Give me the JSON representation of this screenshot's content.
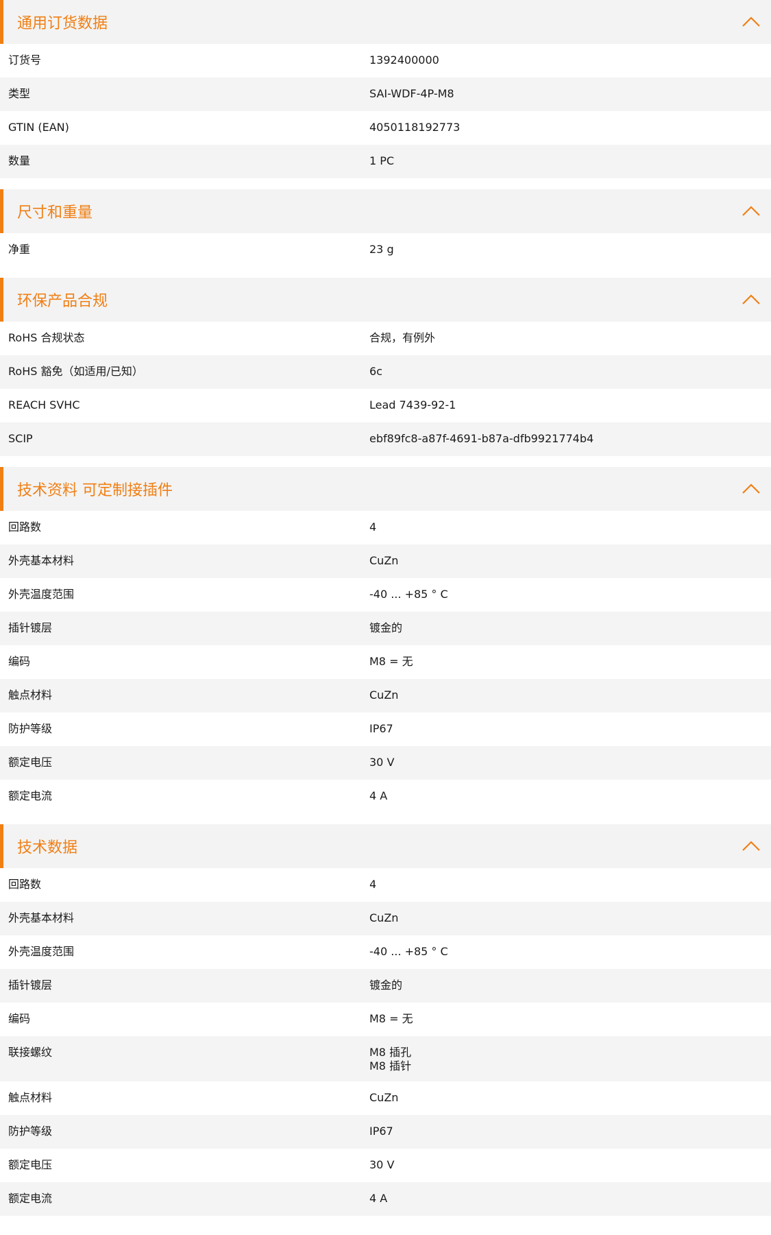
{
  "icons": {
    "collapse": "chevron-up-icon"
  },
  "colors": {
    "accent": "#f07f14",
    "header_bg": "#f3f3f3",
    "row_alt_bg": "#f4f4f4"
  },
  "sections": [
    {
      "key": "ordering",
      "title": "通用订货数据",
      "rows": [
        {
          "label": "订货号",
          "value": "1392400000"
        },
        {
          "label": "类型",
          "value": "SAI-WDF-4P-M8"
        },
        {
          "label": "GTIN (EAN)",
          "value": "4050118192773"
        },
        {
          "label": "数量",
          "value": "1  PC"
        }
      ]
    },
    {
      "key": "dimensions",
      "title": "尺寸和重量",
      "rows": [
        {
          "label": "净重",
          "value": "23  g"
        }
      ]
    },
    {
      "key": "environmental",
      "title": "环保产品合规",
      "rows": [
        {
          "label": "RoHS 合规状态",
          "value": "合规，有例外"
        },
        {
          "label": "RoHS 豁免（如适用/已知）",
          "value": "6c"
        },
        {
          "label": "REACH SVHC",
          "value": "Lead 7439-92-1"
        },
        {
          "label": "SCIP",
          "value": "ebf89fc8-a87f-4691-b87a-dfb9921774b4"
        }
      ]
    },
    {
      "key": "tech-custom",
      "title": "技术资料 可定制接插件",
      "rows": [
        {
          "label": "回路数",
          "value": "4"
        },
        {
          "label": "外壳基本材料",
          "value": "CuZn"
        },
        {
          "label": "外壳温度范围",
          "value": "-40 ... +85 ° C"
        },
        {
          "label": "插针镀层",
          "value": "镀金的"
        },
        {
          "label": "编码",
          "value": "M8 = 无"
        },
        {
          "label": "触点材料",
          "value": "CuZn"
        },
        {
          "label": "防护等级",
          "value": "IP67"
        },
        {
          "label": "额定电压",
          "value": "30  V"
        },
        {
          "label": "额定电流",
          "value": "4  A"
        }
      ]
    },
    {
      "key": "tech",
      "title": "技术数据",
      "rows": [
        {
          "label": "回路数",
          "value": "4"
        },
        {
          "label": "外壳基本材料",
          "value": "CuZn"
        },
        {
          "label": "外壳温度范围",
          "value": "-40 ... +85 ° C"
        },
        {
          "label": "插针镀层",
          "value": "镀金的"
        },
        {
          "label": "编码",
          "value": "M8 = 无"
        },
        {
          "label": "联接螺纹",
          "value": "M8 插孔\nM8 插针"
        },
        {
          "label": "触点材料",
          "value": "CuZn"
        },
        {
          "label": "防护等级",
          "value": "IP67"
        },
        {
          "label": "额定电压",
          "value": "30  V"
        },
        {
          "label": "额定电流",
          "value": "4  A"
        }
      ]
    }
  ]
}
